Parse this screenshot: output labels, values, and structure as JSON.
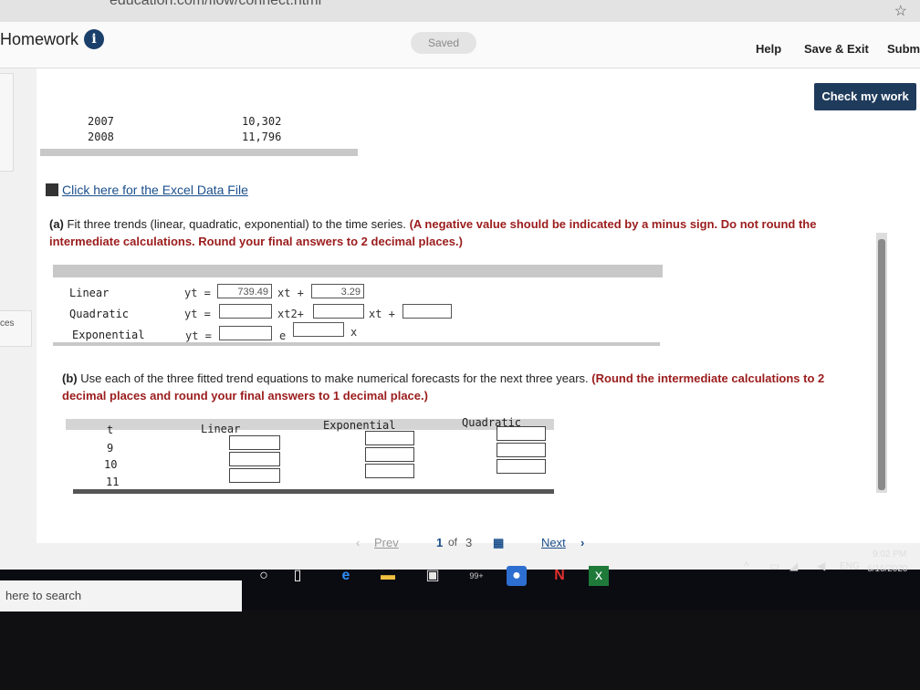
{
  "browser": {
    "url_text": "education.com/flow/connect.html"
  },
  "header": {
    "title": "Homework",
    "saved_badge": "Saved",
    "help": "Help",
    "save_exit": "Save & Exit",
    "submit": "Submi"
  },
  "check_button": "Check my work",
  "data_rows": [
    {
      "year": "2007",
      "value": "10,302"
    },
    {
      "year": "2008",
      "value": "11,796"
    }
  ],
  "excel_link": "Click here for the Excel Data File",
  "part_a": {
    "label": "(a)",
    "text": "Fit three trends (linear, quadratic, exponential) to the time series.",
    "instruction": "(A negative value should be indicated by a minus sign. Do not round the intermediate calculations. Round your final answers to 2 decimal places.)",
    "rows": [
      {
        "name": "Linear",
        "lhs": "yt =",
        "box1": "739.49",
        "term1": "xt +",
        "box2": "3.29"
      },
      {
        "name": "Quadratic",
        "lhs": "yt =",
        "box1": "",
        "term1": "xt2+",
        "box2": "",
        "term2": "xt +",
        "box3": ""
      },
      {
        "name": "Exponential",
        "lhs": "yt =",
        "box1": "",
        "term1": "e",
        "box2": "",
        "term2": "x"
      }
    ]
  },
  "part_b": {
    "label": "(b)",
    "text": "Use each of the three fitted trend equations to make numerical forecasts for the next three years.",
    "instruction": "(Round the intermediate calculations to 2 decimal places and round your final answers to 1 decimal place.)",
    "columns": [
      "t",
      "Linear",
      "Exponential",
      "Quadratic"
    ],
    "t_values": [
      "9",
      "10",
      "11"
    ]
  },
  "pager": {
    "prev": "Prev",
    "current": "1",
    "of": "of",
    "total": "3",
    "next": "Next"
  },
  "left_panel_text": "ces",
  "taskbar": {
    "search_placeholder": "here to search",
    "clock_time": "9:02 PM",
    "clock_date": "6/16/2020",
    "lang": "ENG",
    "badge": "99+"
  },
  "colors": {
    "brand": "#1f3b5c",
    "red_instruction": "#9b1c1c",
    "link": "#1b4f8c"
  }
}
